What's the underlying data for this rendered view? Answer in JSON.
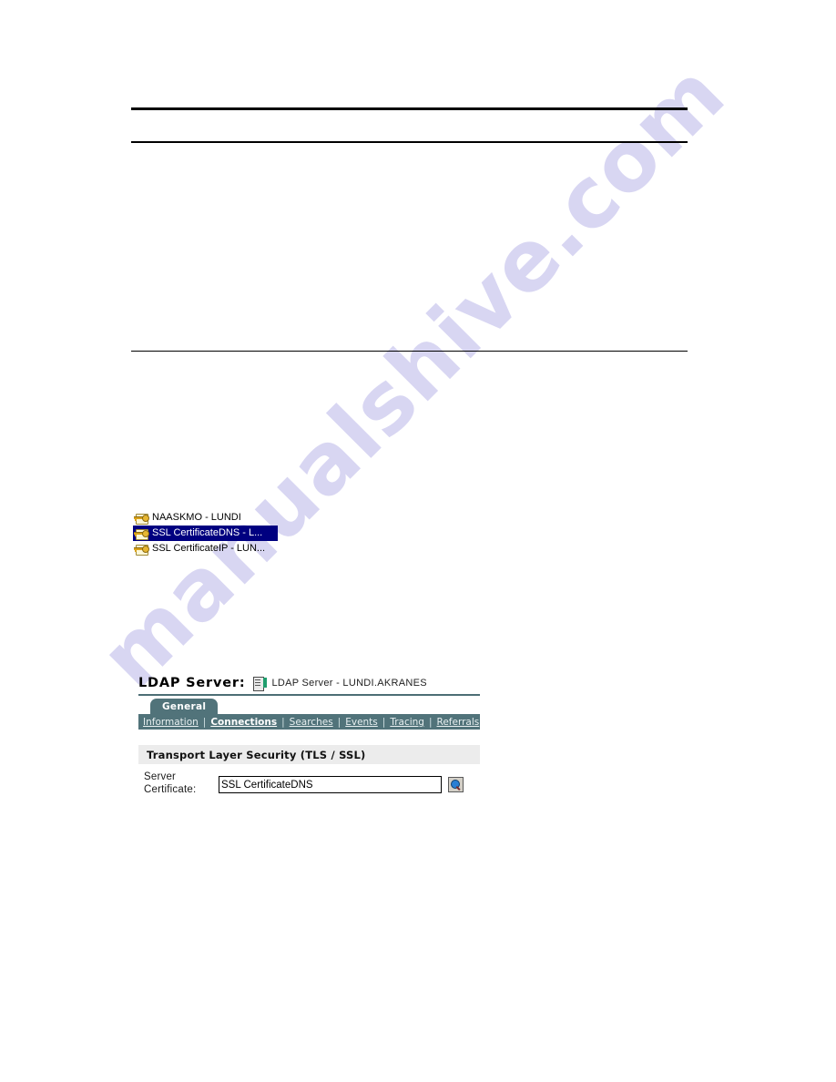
{
  "page": {
    "background_color": "#ffffff",
    "watermark_text": "manualshive.com",
    "watermark_color": "#d6d4f2"
  },
  "rules": [
    {
      "name": "rule-top",
      "color": "#000000"
    },
    {
      "name": "rule-second",
      "color": "#000000"
    },
    {
      "name": "rule-third",
      "color": "#000000"
    }
  ],
  "cert_list": {
    "selection_color": "#000080",
    "items": [
      {
        "label": "NAASKMO - LUNDI",
        "icon": "certificate-icon",
        "selected": false
      },
      {
        "label": "SSL CertificateDNS - L...",
        "icon": "certificate-icon",
        "selected": true
      },
      {
        "label": "SSL CertificateIP - LUN...",
        "icon": "certificate-icon",
        "selected": false
      }
    ]
  },
  "ldap_panel": {
    "title": "LDAP Server:",
    "server_icon": "ldap-server-icon",
    "server_name": "LDAP Server - LUNDI.AKRANES",
    "accent_color": "#51737a",
    "tab": {
      "label": "General"
    },
    "subtabs": [
      {
        "label": "Information",
        "active": false
      },
      {
        "label": "Connections",
        "active": true
      },
      {
        "label": "Searches",
        "active": false
      },
      {
        "label": "Events",
        "active": false
      },
      {
        "label": "Tracing",
        "active": false
      },
      {
        "label": "Referrals",
        "active": false
      }
    ],
    "separator": "|",
    "section": {
      "header": "Transport Layer Security (TLS / SSL)",
      "header_bg": "#ececec",
      "field_label": "Server\nCertificate:",
      "field_label_line1": "Server",
      "field_label_line2": "Certificate:",
      "field_value": "SSL CertificateDNS",
      "field_placeholder": "",
      "browse_icon": "magnifier-icon"
    }
  }
}
